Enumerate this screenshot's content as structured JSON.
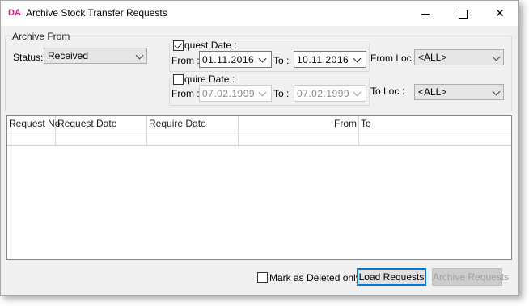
{
  "window": {
    "app_icon_text": "DA",
    "title": "Archive Stock Transfer Requests"
  },
  "archive_from": {
    "group_label": "Archive From",
    "status_label": "Status:",
    "status_value": "Received",
    "request_date": {
      "checked": true,
      "label": "quest Date :",
      "from_label": "From :",
      "from_value": "01.11.2016",
      "to_label": "To :",
      "to_value": "10.11.2016"
    },
    "require_date": {
      "checked": false,
      "label": "quire Date :",
      "from_label": "From :",
      "from_value": "07.02.1999",
      "to_label": "To :",
      "to_value": "07.02.1999"
    },
    "from_loc_label": "From Loc :",
    "from_loc_value": "<ALL>",
    "to_loc_label": "To Loc :",
    "to_loc_value": "<ALL>"
  },
  "grid": {
    "columns": [
      "Request No",
      "Request Date",
      "Require Date",
      "From",
      "To"
    ]
  },
  "footer": {
    "mark_deleted_label": "Mark as Deleted only",
    "mark_deleted_checked": false,
    "load_requests_label": "Load Requests",
    "archive_requests_label": "Archive Requests"
  },
  "colors": {
    "app_icon": "#d0208f",
    "default_button_border": "#0078d7"
  }
}
